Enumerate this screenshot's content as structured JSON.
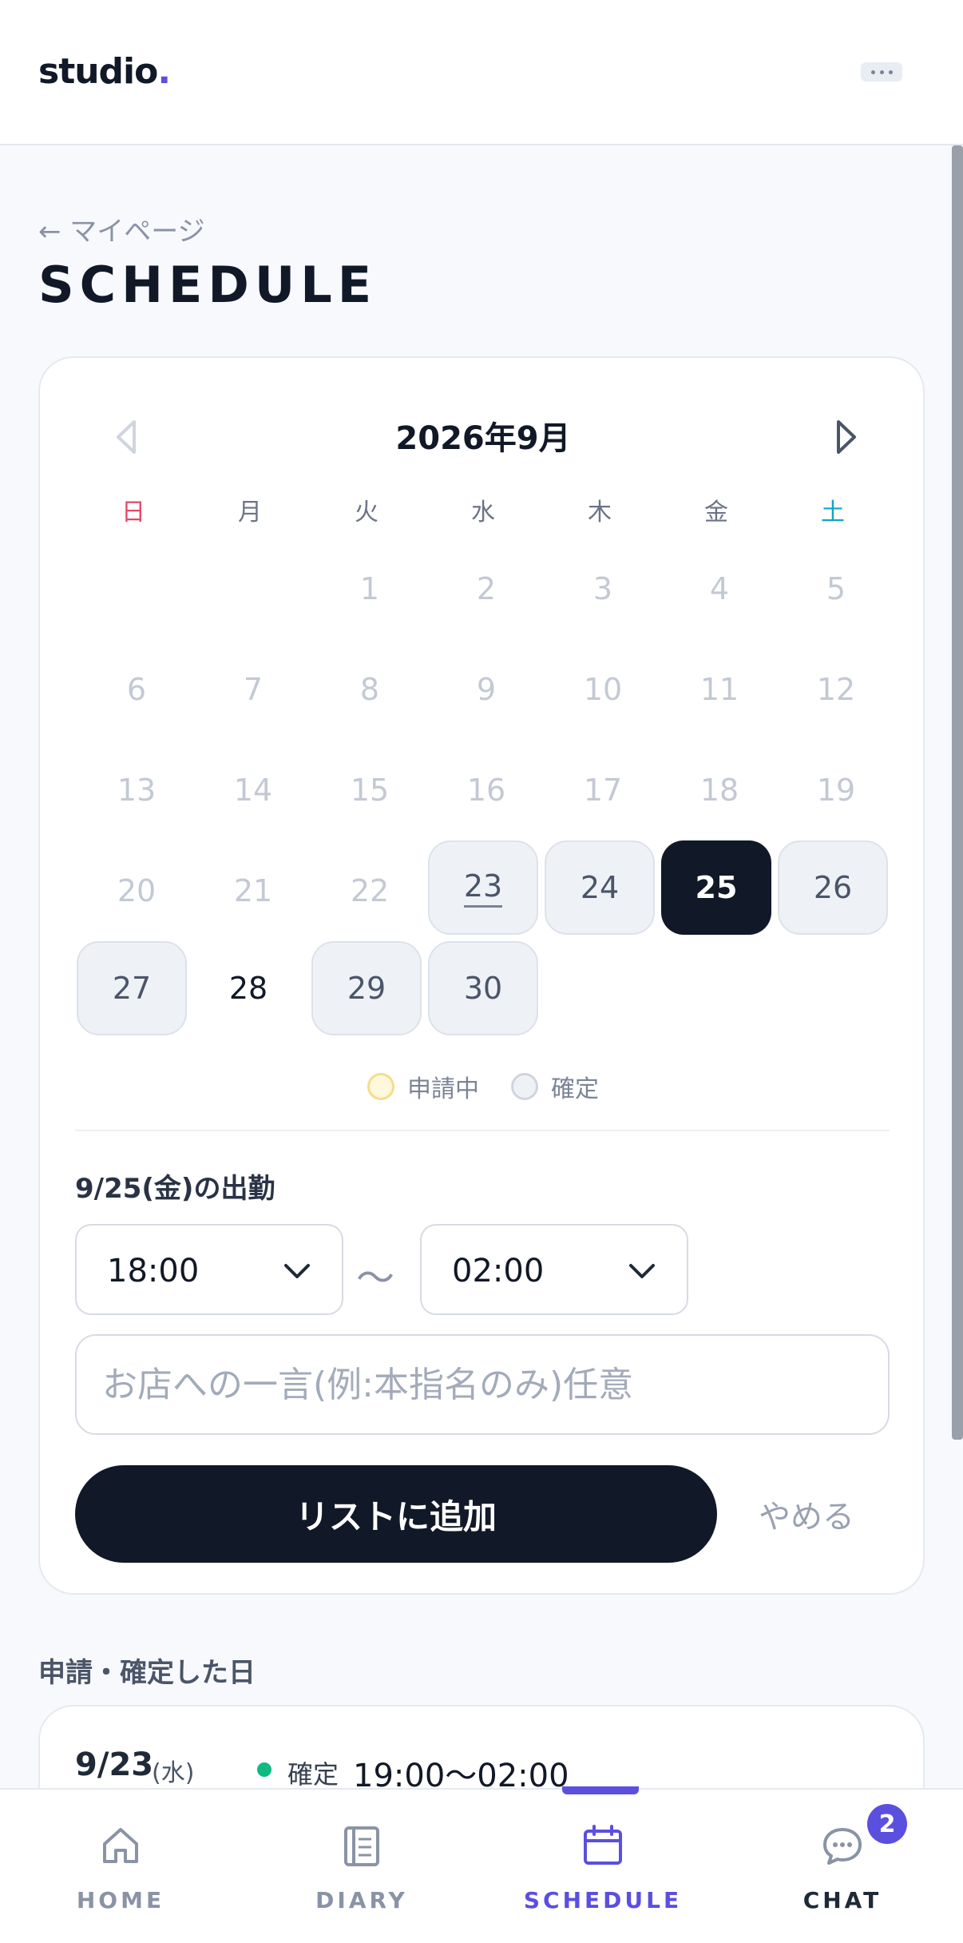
{
  "header": {
    "logo": "studio",
    "logo_dot": "."
  },
  "title_area": {
    "back_link": "← マイページ",
    "title": "SCHEDULE"
  },
  "calendar": {
    "month_label": "2026年9月",
    "weekdays": [
      "日",
      "月",
      "火",
      "水",
      "木",
      "金",
      "土"
    ],
    "days": {
      "d1": "1",
      "d2": "2",
      "d3": "3",
      "d4": "4",
      "d5": "5",
      "d6": "6",
      "d7": "7",
      "d8": "8",
      "d9": "9",
      "d10": "10",
      "d11": "11",
      "d12": "12",
      "d13": "13",
      "d14": "14",
      "d15": "15",
      "d16": "16",
      "d17": "17",
      "d18": "18",
      "d19": "19",
      "d20": "20",
      "d21": "21",
      "d22": "22",
      "d23": "23",
      "d24": "24",
      "d25": "25",
      "d26": "26",
      "d27": "27",
      "d28": "28",
      "d29": "29",
      "d30": "30"
    },
    "selected_day": "25",
    "legend": {
      "pending": "申請中",
      "confirmed": "確定"
    }
  },
  "shift_form": {
    "title": "9/25(金)の出勤",
    "start_time": "18:00",
    "separator": "〜",
    "end_time": "02:00",
    "comment_placeholder": "お店への一言(例:本指名のみ)任意",
    "add_button": "リストに追加",
    "cancel_button": "やめる"
  },
  "requested_list": {
    "heading": "申請・確定した日",
    "entries": [
      {
        "date": "9/23",
        "dow": "(水)",
        "status": "確定",
        "time": "19:00〜02:00"
      }
    ]
  },
  "bottom_nav": {
    "items": [
      {
        "label": "HOME",
        "icon": "home-icon"
      },
      {
        "label": "DIARY",
        "icon": "diary-icon"
      },
      {
        "label": "SCHEDULE",
        "icon": "calendar-icon",
        "active": true
      },
      {
        "label": "CHAT",
        "icon": "chat-icon",
        "badge": "2"
      }
    ]
  },
  "colors": {
    "accent": "#5b4fe0",
    "dark": "#111827",
    "confirmed_dot": "#10b981",
    "sunday": "#e5486a",
    "saturday": "#0ea5c9"
  }
}
